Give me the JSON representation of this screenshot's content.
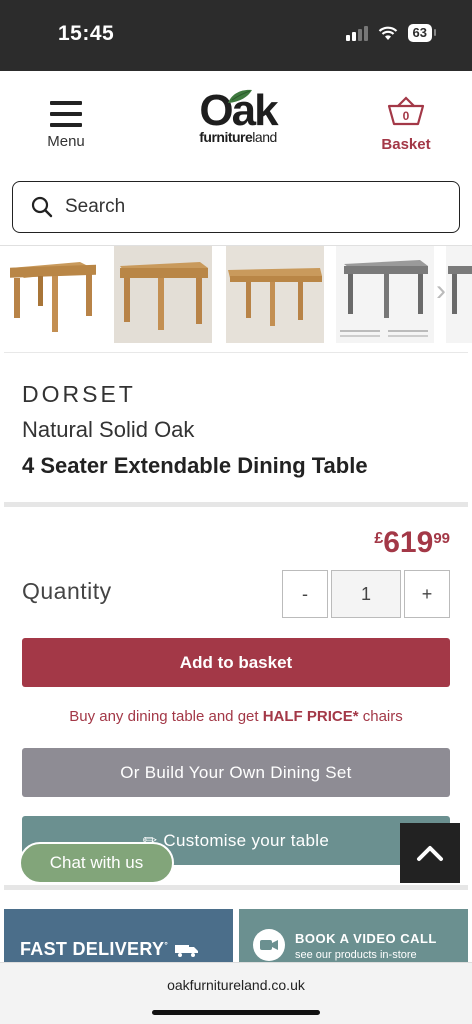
{
  "status": {
    "time": "15:45",
    "battery": "63"
  },
  "header": {
    "menu_label": "Menu",
    "logo_main": "Oak",
    "logo_sub_bold": "furniture",
    "logo_sub_light": "land",
    "basket_label": "Basket",
    "basket_count": "0"
  },
  "search": {
    "placeholder": "Search"
  },
  "product": {
    "collection": "DORSET",
    "subtitle": "Natural Solid Oak",
    "title": "4 Seater Extendable Dining Table",
    "price_currency": "£",
    "price_main": "619",
    "price_pence": "99"
  },
  "quantity": {
    "label": "Quantity",
    "minus": "-",
    "value": "1",
    "plus": "+"
  },
  "actions": {
    "add_to_basket": "Add to basket",
    "promo_prefix": "Buy any dining table and get ",
    "promo_bold": "HALF PRICE*",
    "promo_suffix": " chairs",
    "build_set": "Or Build Your Own Dining Set",
    "customise": "Customise your table",
    "chat": "Chat with us"
  },
  "banners": {
    "delivery": "FAST DELIVERY",
    "video_title": "BOOK A VIDEO CALL",
    "video_sub": "see our products in-store"
  },
  "browser": {
    "url": "oakfurnitureland.co.uk"
  },
  "colors": {
    "brand": "#a33847",
    "build": "#8e8c94",
    "customise": "#6b9090",
    "chat": "#82a57a",
    "delivery": "#4b6e8a"
  }
}
